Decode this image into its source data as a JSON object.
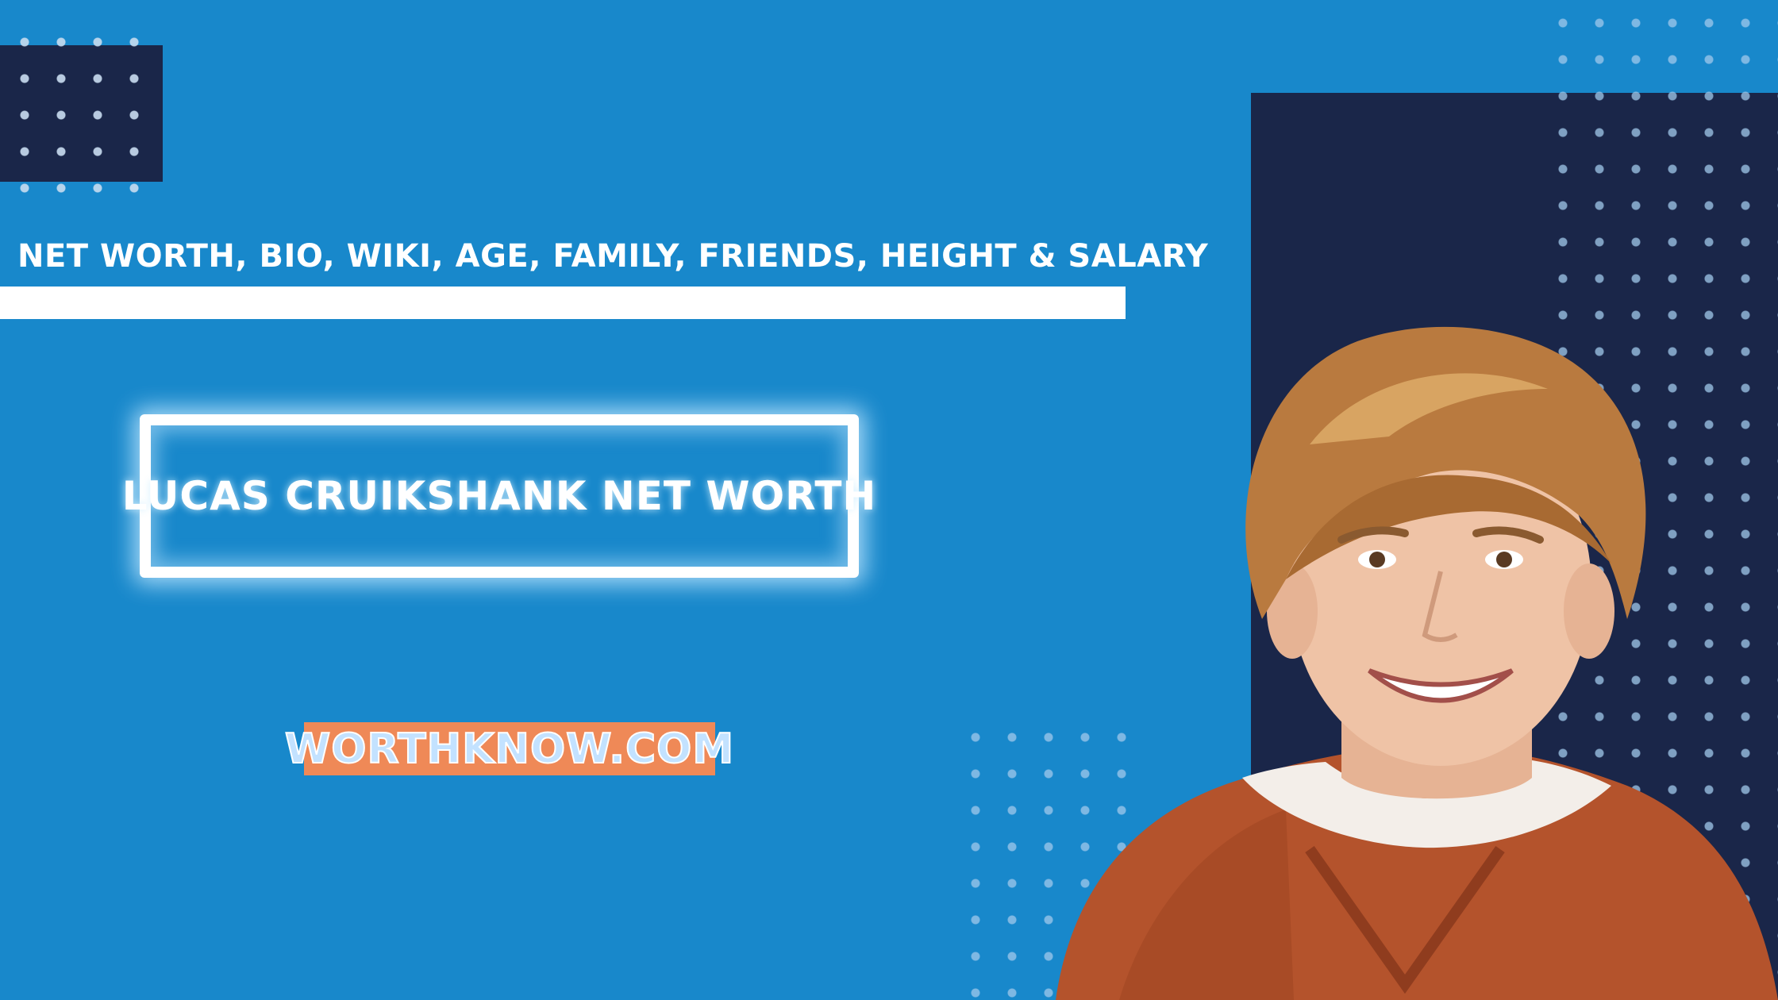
{
  "header": {
    "subtitle": "NET WORTH, BIO, WIKI, AGE, FAMILY, FRIENDS, HEIGHT & SALARY"
  },
  "main": {
    "title": "LUCAS CRUIKSHANK NET WORTH"
  },
  "branding": {
    "site": "WORTHKNOW.COM"
  },
  "colors": {
    "background": "#1888cb",
    "navy": "#1a2649",
    "badge": "#ef8957",
    "text": "#ffffff"
  }
}
